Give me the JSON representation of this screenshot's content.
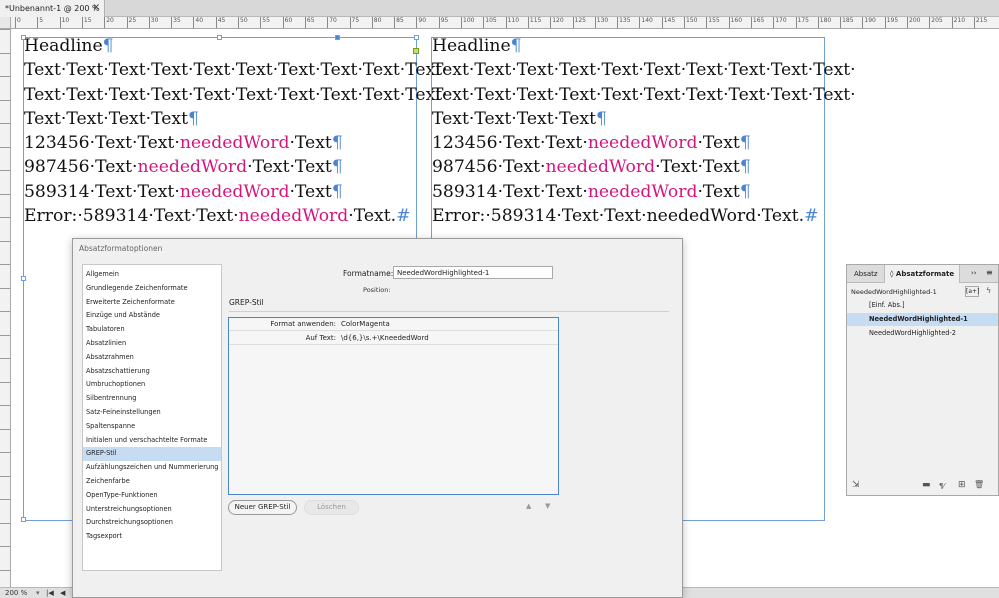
{
  "document_tab": {
    "title": "*Unbenannt-1 @ 200 %",
    "close": "✕"
  },
  "ruler_marks": [
    "0",
    "5",
    "10",
    "15",
    "20",
    "25",
    "30",
    "35",
    "40",
    "45",
    "50",
    "55",
    "60",
    "65",
    "70",
    "75",
    "80",
    "85",
    "90",
    "95",
    "100",
    "105",
    "110",
    "115",
    "120",
    "125",
    "130",
    "135",
    "140",
    "145",
    "150",
    "155",
    "160",
    "165",
    "170",
    "175",
    "180",
    "185",
    "190",
    "195",
    "200",
    "205",
    "210",
    "215"
  ],
  "frame_left": {
    "lines": [
      [
        {
          "t": "Headline"
        },
        {
          "t": "¶",
          "c": "pm"
        }
      ],
      [
        {
          "t": "Text·Text·Text·Text·Text·Text·Text·Text·Text·Text·"
        }
      ],
      [
        {
          "t": "Text·Text·Text·Text·Text·Text·Text·Text·Text·Text·"
        }
      ],
      [
        {
          "t": "Text·Text·Text·Text"
        },
        {
          "t": "¶",
          "c": "pm"
        }
      ],
      [
        {
          "t": "123456·Text·Text·"
        },
        {
          "t": "neededWord",
          "c": "hl"
        },
        {
          "t": "·Text"
        },
        {
          "t": "¶",
          "c": "pm"
        }
      ],
      [
        {
          "t": "987456·Text·"
        },
        {
          "t": "neededWord",
          "c": "hl"
        },
        {
          "t": "·Text·Text"
        },
        {
          "t": "¶",
          "c": "pm"
        }
      ],
      [
        {
          "t": "589314·Text·Text·"
        },
        {
          "t": "neededWord",
          "c": "hl"
        },
        {
          "t": "·Text"
        },
        {
          "t": "¶",
          "c": "pm"
        }
      ],
      [
        {
          "t": "Error:·589314·Text·Text·"
        },
        {
          "t": "neededWord",
          "c": "hl"
        },
        {
          "t": "·Text."
        },
        {
          "t": "#",
          "c": "pm"
        }
      ]
    ]
  },
  "frame_right": {
    "lines": [
      [
        {
          "t": "Headline"
        },
        {
          "t": "¶",
          "c": "pm"
        }
      ],
      [
        {
          "t": "Text·Text·Text·Text·Text·Text·Text·Text·Text·Text·"
        }
      ],
      [
        {
          "t": "Text·Text·Text·Text·Text·Text·Text·Text·Text·Text·"
        }
      ],
      [
        {
          "t": "Text·Text·Text·Text"
        },
        {
          "t": "¶",
          "c": "pm"
        }
      ],
      [
        {
          "t": "123456·Text·Text·"
        },
        {
          "t": "neededWord",
          "c": "hl"
        },
        {
          "t": "·Text"
        },
        {
          "t": "¶",
          "c": "pm"
        }
      ],
      [
        {
          "t": "987456·Text·"
        },
        {
          "t": "neededWord",
          "c": "hl"
        },
        {
          "t": "·Text·Text"
        },
        {
          "t": "¶",
          "c": "pm"
        }
      ],
      [
        {
          "t": "589314·Text·Text·"
        },
        {
          "t": "neededWord",
          "c": "hl"
        },
        {
          "t": "·Text"
        },
        {
          "t": "¶",
          "c": "pm"
        }
      ],
      [
        {
          "t": "Error:·589314·Text·Text·neededWord·Text."
        },
        {
          "t": "#",
          "c": "pm"
        }
      ]
    ]
  },
  "status": {
    "zoom": "200 %",
    "first_page": "|◀",
    "prev_page": "◀"
  },
  "dialog": {
    "title": "Absatzformatoptionen",
    "categories": [
      "Allgemein",
      "Grundlegende Zeichenformate",
      "Erweiterte Zeichenformate",
      "Einzüge und Abstände",
      "Tabulatoren",
      "Absatzlinien",
      "Absatzrahmen",
      "Absatzschattierung",
      "Umbruchoptionen",
      "Silbentrennung",
      "Satz-Feineinstellungen",
      "Spaltenspanne",
      "Initialen und verschachtelte Formate",
      "GREP-Stil",
      "Aufzählungszeichen und Nummerierung",
      "Zeichenfarbe",
      "OpenType-Funktionen",
      "Unterstreichungsoptionen",
      "Durchstreichungsoptionen",
      "Tagsexport"
    ],
    "selected_category": "GREP-Stil",
    "format_name_label": "Formatname:",
    "format_name_value": "NeededWordHighlighted-1",
    "position_label": "Position:",
    "section_title": "GREP-Stil",
    "grep_apply_label": "Format anwenden:",
    "grep_apply_value": "ColorMagenta",
    "grep_text_label": "Auf Text:",
    "grep_text_value": "\\d{6,}\\s.+\\KneededWord",
    "new_grep_button": "Neuer GREP-Stil",
    "delete_button": "Löschen",
    "up_arrow": "▲",
    "down_arrow": "▼"
  },
  "panel": {
    "tab_paragraph": "Absatz",
    "tab_styles": "Absatzformate",
    "tab_styles_icon": "◊",
    "collapse": "››",
    "menu": "≡",
    "current_style": "NeededWordHighlighted-1",
    "new_from_selection": "[a+]",
    "lightning": "ϟ",
    "styles": [
      "[Einf. Abs.]",
      "NeededWordHighlighted-1",
      "NeededWordHighlighted-2"
    ],
    "selected_style": "NeededWordHighlighted-1",
    "icons": {
      "load": "⇲",
      "folder": "▬",
      "clear": "¶⁄",
      "new": "⊞",
      "delete": "🗑"
    }
  },
  "colors": {
    "accent": "#4a86d0",
    "magenta": "#d4157f",
    "selection": "#c6dcf3"
  }
}
